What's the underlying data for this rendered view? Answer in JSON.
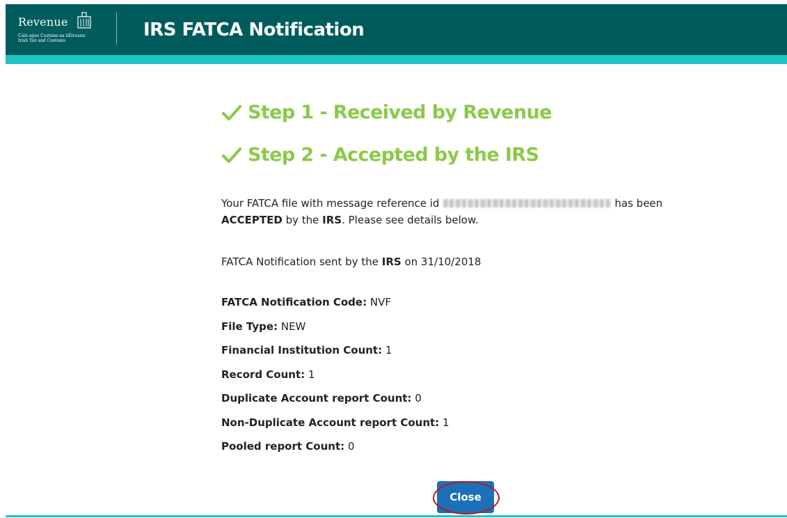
{
  "header": {
    "logo_word": "Revenue",
    "logo_line1": "Cáin agus Custaim na hÉireann",
    "logo_line2": "Irish Tax and Customs",
    "app_title": "IRS FATCA Notification"
  },
  "steps": [
    {
      "label": "Step 1 - Received by Revenue"
    },
    {
      "label": "Step 2 - Accepted by the IRS"
    }
  ],
  "message": {
    "part1": "Your FATCA file with message reference id",
    "part2": "has been",
    "accepted": "ACCEPTED",
    "by_the": "by the",
    "irs": "IRS",
    "part3": ". Please see details below."
  },
  "sent": {
    "prefix": "FATCA Notification sent by the",
    "irs": "IRS",
    "on": "on",
    "date": "31/10/2018"
  },
  "details": [
    {
      "label": "FATCA Notification Code:",
      "value": "NVF"
    },
    {
      "label": "File Type:",
      "value": "NEW"
    },
    {
      "label": "Financial Institution Count:",
      "value": "1"
    },
    {
      "label": "Record Count:",
      "value": "1"
    },
    {
      "label": "Duplicate Account report Count:",
      "value": "0"
    },
    {
      "label": "Non-Duplicate Account report Count:",
      "value": "1"
    },
    {
      "label": "Pooled report Count:",
      "value": "0"
    }
  ],
  "close_label": "Close",
  "colors": {
    "header_bg": "#005c5c",
    "accent_teal": "#1fc3c3",
    "step_green": "#8cc94a",
    "button_blue": "#1d6fb8",
    "highlight_red": "#c0171b"
  }
}
